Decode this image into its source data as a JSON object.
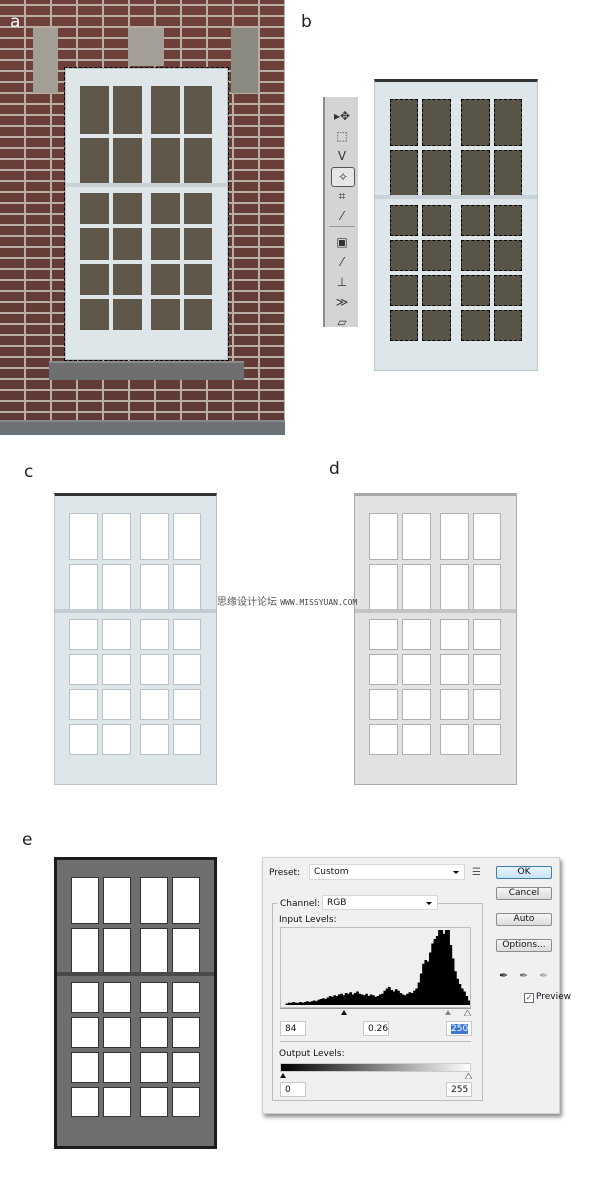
{
  "panels": {
    "a": {
      "label": "a",
      "description": "brick wall with white window, rectangular selection around window"
    },
    "b": {
      "label": "b",
      "description": "window with magic wand selection of glass panes"
    },
    "c": {
      "label": "c",
      "description": "window with glass removed, color"
    },
    "d": {
      "label": "d",
      "description": "window desaturated"
    },
    "e": {
      "label": "e",
      "description": "window after levels adjustment"
    }
  },
  "toolbar": {
    "tools": [
      {
        "name": "move-tool",
        "glyph": "▸✥"
      },
      {
        "name": "rectangular-marquee-tool",
        "glyph": "⬚"
      },
      {
        "name": "lasso-tool",
        "glyph": "ᐯ"
      },
      {
        "name": "magic-wand-tool",
        "glyph": "✧",
        "active": true
      },
      {
        "name": "crop-tool",
        "glyph": "⌗"
      },
      {
        "name": "eyedropper-tool",
        "glyph": "⁄"
      },
      {
        "name": "healing-brush-tool",
        "glyph": "▣"
      },
      {
        "name": "brush-tool",
        "glyph": "⁄"
      },
      {
        "name": "clone-stamp-tool",
        "glyph": "⊥"
      },
      {
        "name": "history-brush-tool",
        "glyph": "≫"
      },
      {
        "name": "eraser-tool",
        "glyph": "▱"
      }
    ]
  },
  "watermark": {
    "chinese": "思缘设计论坛",
    "url": "WWW.MISSYUAN.COM"
  },
  "levels_dialog": {
    "preset_label": "Preset:",
    "preset_value": "Custom",
    "channel_label": "Channel:",
    "channel_value": "RGB",
    "input_levels_label": "Input Levels:",
    "input_black": "84",
    "input_gamma": "0.26",
    "input_white": "250",
    "output_levels_label": "Output Levels:",
    "output_black": "0",
    "output_white": "255",
    "buttons": {
      "ok": "OK",
      "cancel": "Cancel",
      "auto": "Auto",
      "options": "Options..."
    },
    "preview_label": "Preview",
    "preview_checked": true,
    "histogram": [
      0,
      0,
      2,
      3,
      3,
      4,
      3,
      3,
      4,
      3,
      4,
      5,
      4,
      5,
      6,
      5,
      7,
      8,
      9,
      8,
      10,
      12,
      11,
      13,
      12,
      14,
      15,
      13,
      16,
      15,
      17,
      14,
      16,
      18,
      15,
      14,
      13,
      15,
      12,
      14,
      13,
      11,
      12,
      14,
      15,
      19,
      22,
      24,
      20,
      18,
      21,
      19,
      16,
      14,
      13,
      15,
      17,
      16,
      19,
      22,
      30,
      42,
      55,
      60,
      58,
      70,
      82,
      88,
      92,
      100,
      100,
      95,
      100,
      100,
      80,
      62,
      45,
      35,
      28,
      22,
      18,
      12,
      6
    ]
  }
}
